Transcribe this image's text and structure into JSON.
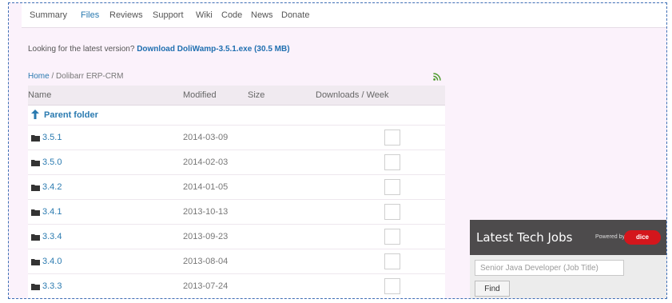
{
  "nav": {
    "items": [
      "Summary",
      "Files",
      "Reviews",
      "Support",
      "Wiki",
      "Code",
      "News",
      "Donate"
    ],
    "active": "Files"
  },
  "latest": {
    "prefix": "Looking for the latest version?",
    "link": "Download DoliWamp-3.5.1.exe (30.5 MB)"
  },
  "breadcrumb": {
    "home": "Home",
    "separator": "/",
    "current": "Dolibarr ERP-CRM"
  },
  "table": {
    "headers": {
      "name": "Name",
      "modified": "Modified",
      "size": "Size",
      "downloads": "Downloads / Week"
    },
    "parent_label": "Parent folder",
    "rows": [
      {
        "name": "3.5.1",
        "modified": "2014-03-09"
      },
      {
        "name": "3.5.0",
        "modified": "2014-02-03"
      },
      {
        "name": "3.4.2",
        "modified": "2014-01-05"
      },
      {
        "name": "3.4.1",
        "modified": "2013-10-13"
      },
      {
        "name": "3.3.4",
        "modified": "2013-09-23"
      },
      {
        "name": "3.4.0",
        "modified": "2013-08-04"
      },
      {
        "name": "3.3.3",
        "modified": "2013-07-24"
      }
    ]
  },
  "jobs": {
    "title": "Latest Tech Jobs",
    "powered_by": "Powered by",
    "brand": "dice",
    "search_placeholder": "Senior Java Developer (Job Title)",
    "find_label": "Find"
  },
  "colors": {
    "link": "#2a7ab0",
    "page_bg": "#fbf2fb",
    "jobs_header": "#4d4b4c",
    "dice_red": "#d4161c",
    "rss": "#4f9b2f"
  }
}
